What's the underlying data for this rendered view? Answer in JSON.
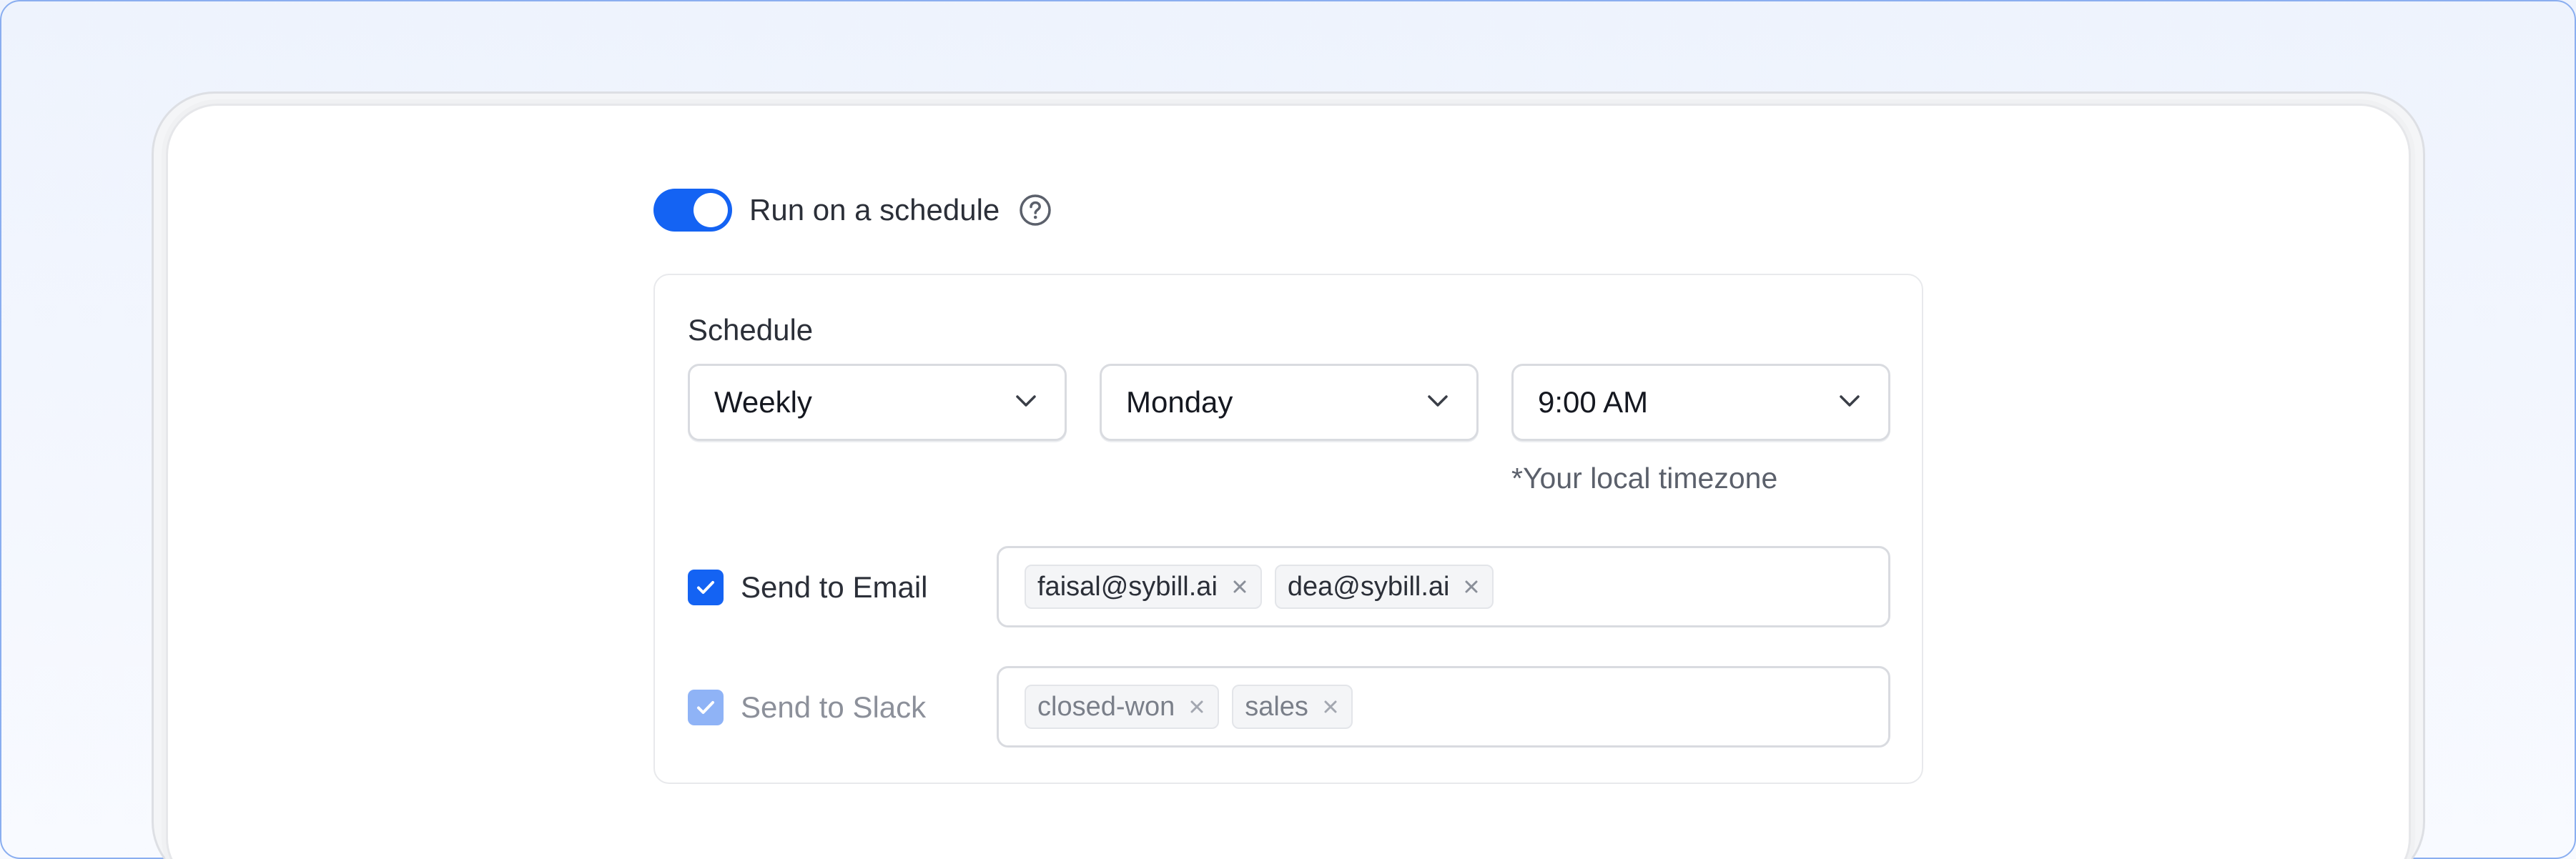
{
  "schedule_toggle": {
    "label": "Run on a schedule",
    "enabled": true,
    "help_icon": "question-circle-icon"
  },
  "schedule": {
    "title": "Schedule",
    "frequency": "Weekly",
    "day": "Monday",
    "time": "9:00 AM",
    "timezone_note": "*Your local timezone"
  },
  "destinations": {
    "email": {
      "label": "Send to Email",
      "checked": true,
      "chips": [
        "faisal@sybill.ai",
        "dea@sybill.ai"
      ]
    },
    "slack": {
      "label": "Send to Slack",
      "checked": true,
      "disabled": true,
      "chips": [
        "closed-won",
        "sales"
      ]
    }
  },
  "colors": {
    "accent": "#1463f3",
    "accent_disabled": "#8fb3f6",
    "frame_border": "#8aaef0"
  }
}
